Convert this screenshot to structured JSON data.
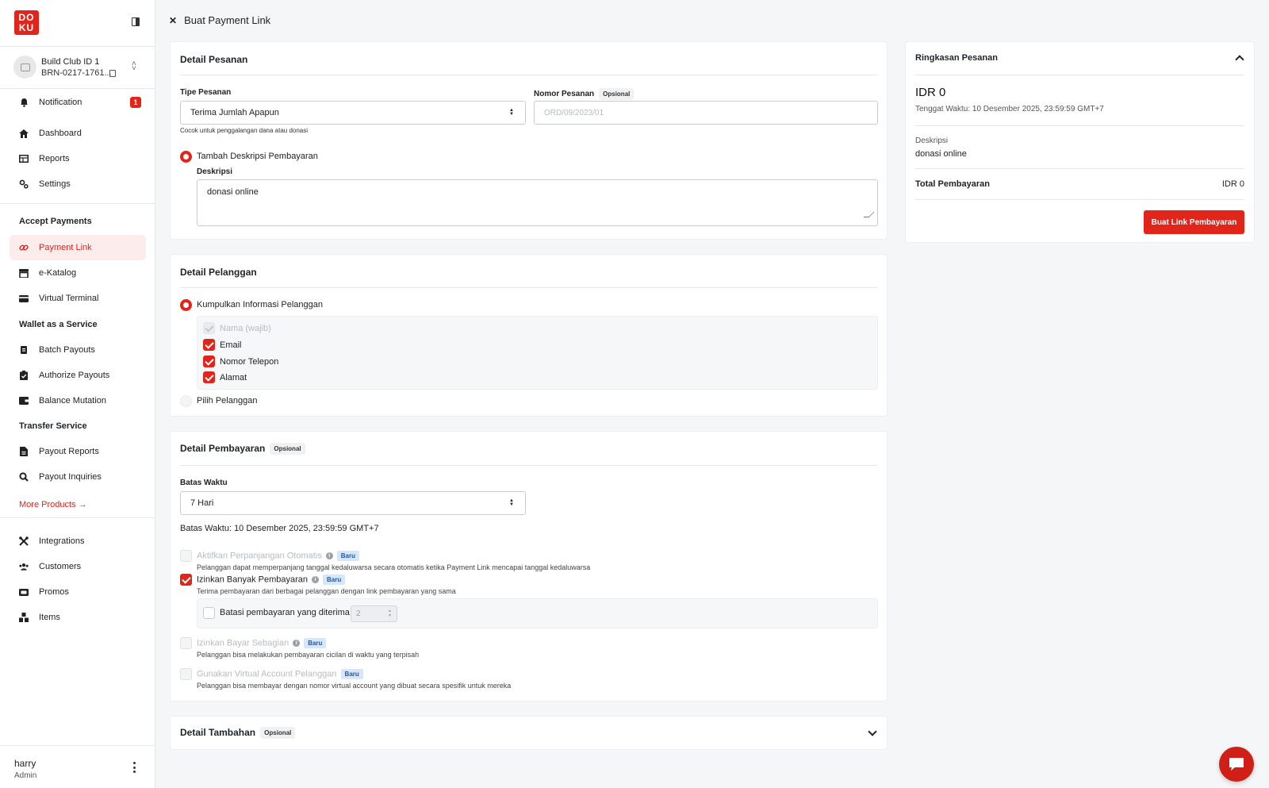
{
  "sidebar": {
    "logo_top": "DO",
    "logo_bottom": "KU",
    "account": {
      "name": "Build Club ID 1",
      "id": "BRN-0217-1761..."
    },
    "notification": {
      "label": "Notification",
      "badge": "1"
    },
    "main_items": [
      {
        "label": "Dashboard",
        "icon": "home-icon"
      },
      {
        "label": "Reports",
        "icon": "table-icon"
      },
      {
        "label": "Settings",
        "icon": "gears-icon"
      }
    ],
    "accept_payments": {
      "title": "Accept Payments",
      "items": [
        {
          "label": "Payment Link",
          "icon": "link-icon",
          "active": true
        },
        {
          "label": "e-Katalog",
          "icon": "store-icon"
        },
        {
          "label": "Virtual Terminal",
          "icon": "card-icon"
        }
      ]
    },
    "wallet": {
      "title": "Wallet as a Service",
      "items": [
        {
          "label": "Batch Payouts",
          "icon": "batch-icon"
        },
        {
          "label": "Authorize Payouts",
          "icon": "clipboard-check-icon"
        },
        {
          "label": "Balance Mutation",
          "icon": "wallet-icon"
        }
      ]
    },
    "transfer": {
      "title": "Transfer Service",
      "items": [
        {
          "label": "Payout Reports",
          "icon": "file-icon"
        },
        {
          "label": "Payout Inquiries",
          "icon": "search-doc-icon"
        }
      ]
    },
    "more_products": "More Products →",
    "bottom_items": [
      {
        "label": "Integrations",
        "icon": "tools-icon"
      },
      {
        "label": "Customers",
        "icon": "users-icon"
      },
      {
        "label": "Promos",
        "icon": "ticket-icon"
      },
      {
        "label": "Items",
        "icon": "boxes-icon"
      }
    ],
    "user": {
      "name": "harry",
      "role": "Admin"
    }
  },
  "header": {
    "title": "Buat Payment Link"
  },
  "detail_pesanan": {
    "title": "Detail Pesanan",
    "tipe_label": "Tipe Pesanan",
    "tipe_value": "Terima Jumlah Apapun",
    "tipe_hint": "Cocok untuk penggalangan dana atau donasi",
    "nomor_label": "Nomor Pesanan",
    "opsional": "Opsional",
    "nomor_placeholder": "ORD/09/2023/01",
    "radio_label": "Tambah Deskripsi Pembayaran",
    "deskripsi_label": "Deskripsi",
    "deskripsi_value": "donasi online"
  },
  "detail_pelanggan": {
    "title": "Detail Pelanggan",
    "radio_collect": "Kumpulkan Informasi Pelanggan",
    "fields": [
      {
        "label": "Nama (wajib)",
        "state": "disabled-checked"
      },
      {
        "label": "Email",
        "state": "checked"
      },
      {
        "label": "Nomor Telepon",
        "state": "checked"
      },
      {
        "label": "Alamat",
        "state": "checked"
      }
    ],
    "radio_pilih": "Pilih Pelanggan"
  },
  "detail_pembayaran": {
    "title": "Detail Pembayaran",
    "opsional": "Opsional",
    "batas_label": "Batas Waktu",
    "batas_value": "7 Hari",
    "batas_text": "Batas Waktu: 10 Desember 2025, 23:59:59 GMT+7",
    "baru": "Baru",
    "options": [
      {
        "label": "Aktifkan Perpanjangan Otomatis",
        "desc": "Pelanggan dapat memperpanjang tanggal kedaluwarsa secara otomatis ketika Payment Link mencapai tanggal kedaluwarsa",
        "checked": false,
        "disabled": true,
        "info": true
      },
      {
        "label": "Izinkan Banyak Pembayaran",
        "desc": "Terima pembayaran dari berbagai pelanggan dengan link pembayaran yang sama",
        "checked": true,
        "disabled": false,
        "info": true
      },
      {
        "label": "Izinkan Bayar Sebagian",
        "desc": "Pelanggan bisa melakukan pembayaran cicilan di waktu yang terpisah",
        "checked": false,
        "disabled": true,
        "info": true
      },
      {
        "label": "Gunakan Virtual Account Pelanggan",
        "desc": "Pelanggan bisa membayar dengan nomor virtual account yang dibuat secara spesifik untuk mereka",
        "checked": false,
        "disabled": true,
        "info": false
      }
    ],
    "limit_label": "Batasi pembayaran yang diterima",
    "limit_value": "2"
  },
  "detail_tambahan": {
    "title": "Detail Tambahan",
    "opsional": "Opsional"
  },
  "ringkasan": {
    "title": "Ringkasan Pesanan",
    "amount": "IDR 0",
    "tenggat": "Tenggat Waktu: 10 Desember 2025, 23:59:59 GMT+7",
    "deskripsi_label": "Deskripsi",
    "deskripsi_value": "donasi online",
    "total_label": "Total Pembayaran",
    "total_value": "IDR 0",
    "button": "Buat Link Pembayaran"
  },
  "colors": {
    "brand_red": "#e1251b",
    "badge_blue": "#d6e6fb",
    "bg": "#f5f6f8"
  }
}
